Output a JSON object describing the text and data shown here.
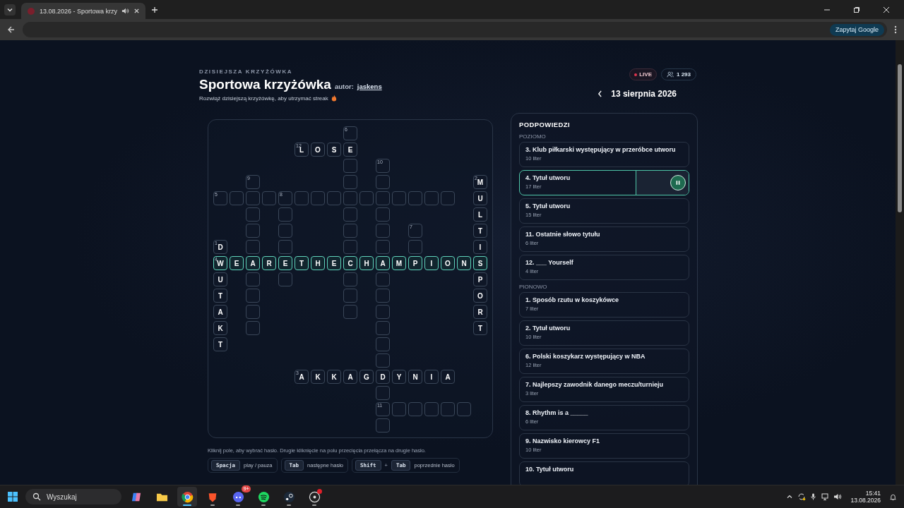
{
  "browser": {
    "tab_title": "13.08.2026 - Sportowa krzy",
    "ask_google": "Zapytaj Google"
  },
  "header": {
    "eyebrow": "DZISIEJSZA KRZYŻÓWKA",
    "title": "Sportowa krzyżówka",
    "author_label": "autor:",
    "author": "jaskens",
    "subtitle": "Rozwiąż dzisiejszą krzyżówkę, aby utrzymać streak",
    "live": "LIVE",
    "viewers": "1 293",
    "date": "13 sierpnia 2026"
  },
  "grid": [
    [
      {
        "kind": "empty"
      },
      {
        "kind": "empty"
      },
      {
        "kind": "empty"
      },
      {
        "kind": "empty"
      },
      {
        "kind": "empty"
      },
      {
        "kind": "empty"
      },
      {
        "kind": "empty"
      },
      {
        "kind": "empty"
      },
      {
        "kind": "square",
        "number": "6",
        "active": false
      },
      {
        "kind": "empty"
      },
      {
        "kind": "empty"
      },
      {
        "kind": "empty"
      },
      {
        "kind": "empty"
      },
      {
        "kind": "empty"
      },
      {
        "kind": "empty"
      },
      {
        "kind": "empty"
      },
      {
        "kind": "empty"
      }
    ],
    [
      {
        "kind": "empty"
      },
      {
        "kind": "empty"
      },
      {
        "kind": "empty"
      },
      {
        "kind": "empty"
      },
      {
        "kind": "empty"
      },
      {
        "kind": "square",
        "number": "12",
        "letter": "L",
        "active": false
      },
      {
        "kind": "square",
        "letter": "O",
        "active": false
      },
      {
        "kind": "square",
        "letter": "S",
        "active": false
      },
      {
        "kind": "square",
        "letter": "E",
        "active": false
      },
      {
        "kind": "empty"
      },
      {
        "kind": "empty"
      },
      {
        "kind": "empty"
      },
      {
        "kind": "empty"
      },
      {
        "kind": "empty"
      },
      {
        "kind": "empty"
      },
      {
        "kind": "empty"
      },
      {
        "kind": "empty"
      }
    ],
    [
      {
        "kind": "empty"
      },
      {
        "kind": "empty"
      },
      {
        "kind": "empty"
      },
      {
        "kind": "empty"
      },
      {
        "kind": "empty"
      },
      {
        "kind": "empty"
      },
      {
        "kind": "empty"
      },
      {
        "kind": "empty"
      },
      {
        "kind": "square",
        "active": false
      },
      {
        "kind": "empty"
      },
      {
        "kind": "square",
        "number": "10",
        "active": false
      },
      {
        "kind": "empty"
      },
      {
        "kind": "empty"
      },
      {
        "kind": "empty"
      },
      {
        "kind": "empty"
      },
      {
        "kind": "empty"
      },
      {
        "kind": "empty"
      }
    ],
    [
      {
        "kind": "empty"
      },
      {
        "kind": "empty"
      },
      {
        "kind": "square",
        "number": "9",
        "active": false
      },
      {
        "kind": "empty"
      },
      {
        "kind": "empty"
      },
      {
        "kind": "empty"
      },
      {
        "kind": "empty"
      },
      {
        "kind": "empty"
      },
      {
        "kind": "square",
        "active": false
      },
      {
        "kind": "empty"
      },
      {
        "kind": "square",
        "active": false
      },
      {
        "kind": "empty"
      },
      {
        "kind": "empty"
      },
      {
        "kind": "empty"
      },
      {
        "kind": "empty"
      },
      {
        "kind": "empty"
      },
      {
        "kind": "square",
        "number": "2",
        "letter": "M",
        "active": false
      }
    ],
    [
      {
        "kind": "square",
        "number": "5",
        "active": false
      },
      {
        "kind": "square",
        "active": false
      },
      {
        "kind": "square",
        "active": false
      },
      {
        "kind": "square",
        "active": false
      },
      {
        "kind": "square",
        "number": "8",
        "active": false
      },
      {
        "kind": "square",
        "active": false
      },
      {
        "kind": "square",
        "active": false
      },
      {
        "kind": "square",
        "active": false
      },
      {
        "kind": "square",
        "active": false
      },
      {
        "kind": "square",
        "active": false
      },
      {
        "kind": "square",
        "active": false
      },
      {
        "kind": "square",
        "active": false
      },
      {
        "kind": "square",
        "active": false
      },
      {
        "kind": "square",
        "active": false
      },
      {
        "kind": "square",
        "active": false
      },
      {
        "kind": "empty"
      },
      {
        "kind": "square",
        "letter": "U",
        "active": false
      }
    ],
    [
      {
        "kind": "empty"
      },
      {
        "kind": "empty"
      },
      {
        "kind": "square",
        "active": false
      },
      {
        "kind": "empty"
      },
      {
        "kind": "square",
        "active": false
      },
      {
        "kind": "empty"
      },
      {
        "kind": "empty"
      },
      {
        "kind": "empty"
      },
      {
        "kind": "square",
        "active": false
      },
      {
        "kind": "empty"
      },
      {
        "kind": "square",
        "active": false
      },
      {
        "kind": "empty"
      },
      {
        "kind": "empty"
      },
      {
        "kind": "empty"
      },
      {
        "kind": "empty"
      },
      {
        "kind": "empty"
      },
      {
        "kind": "square",
        "letter": "L",
        "active": false
      }
    ],
    [
      {
        "kind": "empty"
      },
      {
        "kind": "empty"
      },
      {
        "kind": "square",
        "active": false
      },
      {
        "kind": "empty"
      },
      {
        "kind": "square",
        "active": false
      },
      {
        "kind": "empty"
      },
      {
        "kind": "empty"
      },
      {
        "kind": "empty"
      },
      {
        "kind": "square",
        "active": false
      },
      {
        "kind": "empty"
      },
      {
        "kind": "square",
        "active": false
      },
      {
        "kind": "empty"
      },
      {
        "kind": "square",
        "number": "7",
        "active": false
      },
      {
        "kind": "empty"
      },
      {
        "kind": "empty"
      },
      {
        "kind": "empty"
      },
      {
        "kind": "square",
        "letter": "T",
        "active": false
      }
    ],
    [
      {
        "kind": "square",
        "number": "1",
        "letter": "D",
        "active": false
      },
      {
        "kind": "empty"
      },
      {
        "kind": "square",
        "active": false
      },
      {
        "kind": "empty"
      },
      {
        "kind": "square",
        "active": false
      },
      {
        "kind": "empty"
      },
      {
        "kind": "empty"
      },
      {
        "kind": "empty"
      },
      {
        "kind": "square",
        "active": false
      },
      {
        "kind": "empty"
      },
      {
        "kind": "square",
        "active": false
      },
      {
        "kind": "empty"
      },
      {
        "kind": "square",
        "active": false
      },
      {
        "kind": "empty"
      },
      {
        "kind": "empty"
      },
      {
        "kind": "empty"
      },
      {
        "kind": "square",
        "letter": "I",
        "active": false
      }
    ],
    [
      {
        "kind": "square",
        "number": "4",
        "letter": "W",
        "active": true
      },
      {
        "kind": "square",
        "letter": "E",
        "active": true
      },
      {
        "kind": "square",
        "letter": "A",
        "active": true
      },
      {
        "kind": "square",
        "letter": "R",
        "active": true
      },
      {
        "kind": "square",
        "letter": "E",
        "active": true
      },
      {
        "kind": "square",
        "letter": "T",
        "active": true
      },
      {
        "kind": "square",
        "letter": "H",
        "active": true
      },
      {
        "kind": "square",
        "letter": "E",
        "active": true
      },
      {
        "kind": "square",
        "letter": "C",
        "active": true
      },
      {
        "kind": "square",
        "letter": "H",
        "active": true
      },
      {
        "kind": "square",
        "letter": "A",
        "active": true
      },
      {
        "kind": "square",
        "letter": "M",
        "active": true
      },
      {
        "kind": "square",
        "letter": "P",
        "active": true
      },
      {
        "kind": "square",
        "letter": "I",
        "active": true
      },
      {
        "kind": "square",
        "letter": "O",
        "active": true
      },
      {
        "kind": "square",
        "letter": "N",
        "active": true
      },
      {
        "kind": "square",
        "letter": "S",
        "active": true
      }
    ],
    [
      {
        "kind": "square",
        "letter": "U",
        "active": false
      },
      {
        "kind": "empty"
      },
      {
        "kind": "square",
        "active": false
      },
      {
        "kind": "empty"
      },
      {
        "kind": "square",
        "active": false
      },
      {
        "kind": "empty"
      },
      {
        "kind": "empty"
      },
      {
        "kind": "empty"
      },
      {
        "kind": "square",
        "active": false
      },
      {
        "kind": "empty"
      },
      {
        "kind": "square",
        "active": false
      },
      {
        "kind": "empty"
      },
      {
        "kind": "empty"
      },
      {
        "kind": "empty"
      },
      {
        "kind": "empty"
      },
      {
        "kind": "empty"
      },
      {
        "kind": "square",
        "letter": "P",
        "active": false
      }
    ],
    [
      {
        "kind": "square",
        "letter": "T",
        "active": false
      },
      {
        "kind": "empty"
      },
      {
        "kind": "square",
        "active": false
      },
      {
        "kind": "empty"
      },
      {
        "kind": "empty"
      },
      {
        "kind": "empty"
      },
      {
        "kind": "empty"
      },
      {
        "kind": "empty"
      },
      {
        "kind": "square",
        "active": false
      },
      {
        "kind": "empty"
      },
      {
        "kind": "square",
        "active": false
      },
      {
        "kind": "empty"
      },
      {
        "kind": "empty"
      },
      {
        "kind": "empty"
      },
      {
        "kind": "empty"
      },
      {
        "kind": "empty"
      },
      {
        "kind": "square",
        "letter": "O",
        "active": false
      }
    ],
    [
      {
        "kind": "square",
        "letter": "A",
        "active": false
      },
      {
        "kind": "empty"
      },
      {
        "kind": "square",
        "active": false
      },
      {
        "kind": "empty"
      },
      {
        "kind": "empty"
      },
      {
        "kind": "empty"
      },
      {
        "kind": "empty"
      },
      {
        "kind": "empty"
      },
      {
        "kind": "square",
        "active": false
      },
      {
        "kind": "empty"
      },
      {
        "kind": "square",
        "active": false
      },
      {
        "kind": "empty"
      },
      {
        "kind": "empty"
      },
      {
        "kind": "empty"
      },
      {
        "kind": "empty"
      },
      {
        "kind": "empty"
      },
      {
        "kind": "square",
        "letter": "R",
        "active": false
      }
    ],
    [
      {
        "kind": "square",
        "letter": "K",
        "active": false
      },
      {
        "kind": "empty"
      },
      {
        "kind": "square",
        "active": false
      },
      {
        "kind": "empty"
      },
      {
        "kind": "empty"
      },
      {
        "kind": "empty"
      },
      {
        "kind": "empty"
      },
      {
        "kind": "empty"
      },
      {
        "kind": "empty"
      },
      {
        "kind": "empty"
      },
      {
        "kind": "square",
        "active": false
      },
      {
        "kind": "empty"
      },
      {
        "kind": "empty"
      },
      {
        "kind": "empty"
      },
      {
        "kind": "empty"
      },
      {
        "kind": "empty"
      },
      {
        "kind": "square",
        "letter": "T",
        "active": false
      }
    ],
    [
      {
        "kind": "square",
        "letter": "T",
        "active": false
      },
      {
        "kind": "empty"
      },
      {
        "kind": "empty"
      },
      {
        "kind": "empty"
      },
      {
        "kind": "empty"
      },
      {
        "kind": "empty"
      },
      {
        "kind": "empty"
      },
      {
        "kind": "empty"
      },
      {
        "kind": "empty"
      },
      {
        "kind": "empty"
      },
      {
        "kind": "square",
        "active": false
      },
      {
        "kind": "empty"
      },
      {
        "kind": "empty"
      },
      {
        "kind": "empty"
      },
      {
        "kind": "empty"
      },
      {
        "kind": "empty"
      },
      {
        "kind": "empty"
      }
    ],
    [
      {
        "kind": "empty"
      },
      {
        "kind": "empty"
      },
      {
        "kind": "empty"
      },
      {
        "kind": "empty"
      },
      {
        "kind": "empty"
      },
      {
        "kind": "empty"
      },
      {
        "kind": "empty"
      },
      {
        "kind": "empty"
      },
      {
        "kind": "empty"
      },
      {
        "kind": "empty"
      },
      {
        "kind": "square",
        "active": false
      },
      {
        "kind": "empty"
      },
      {
        "kind": "empty"
      },
      {
        "kind": "empty"
      },
      {
        "kind": "empty"
      },
      {
        "kind": "empty"
      },
      {
        "kind": "empty"
      }
    ],
    [
      {
        "kind": "empty"
      },
      {
        "kind": "empty"
      },
      {
        "kind": "empty"
      },
      {
        "kind": "empty"
      },
      {
        "kind": "empty"
      },
      {
        "kind": "square",
        "number": "3",
        "letter": "A",
        "active": false
      },
      {
        "kind": "square",
        "letter": "K",
        "active": false
      },
      {
        "kind": "square",
        "letter": "K",
        "active": false
      },
      {
        "kind": "square",
        "letter": "A",
        "active": false
      },
      {
        "kind": "square",
        "letter": "G",
        "active": false
      },
      {
        "kind": "square",
        "letter": "D",
        "active": false
      },
      {
        "kind": "square",
        "letter": "Y",
        "active": false
      },
      {
        "kind": "square",
        "letter": "N",
        "active": false
      },
      {
        "kind": "square",
        "letter": "I",
        "active": false
      },
      {
        "kind": "square",
        "letter": "A",
        "active": false
      },
      {
        "kind": "empty"
      },
      {
        "kind": "empty"
      }
    ],
    [
      {
        "kind": "empty"
      },
      {
        "kind": "empty"
      },
      {
        "kind": "empty"
      },
      {
        "kind": "empty"
      },
      {
        "kind": "empty"
      },
      {
        "kind": "empty"
      },
      {
        "kind": "empty"
      },
      {
        "kind": "empty"
      },
      {
        "kind": "empty"
      },
      {
        "kind": "empty"
      },
      {
        "kind": "square",
        "active": false
      },
      {
        "kind": "empty"
      },
      {
        "kind": "empty"
      },
      {
        "kind": "empty"
      },
      {
        "kind": "empty"
      },
      {
        "kind": "empty"
      },
      {
        "kind": "empty"
      }
    ],
    [
      {
        "kind": "empty"
      },
      {
        "kind": "empty"
      },
      {
        "kind": "empty"
      },
      {
        "kind": "empty"
      },
      {
        "kind": "empty"
      },
      {
        "kind": "empty"
      },
      {
        "kind": "empty"
      },
      {
        "kind": "empty"
      },
      {
        "kind": "empty"
      },
      {
        "kind": "empty"
      },
      {
        "kind": "square",
        "number": "11",
        "active": false
      },
      {
        "kind": "square",
        "active": false
      },
      {
        "kind": "square",
        "active": false
      },
      {
        "kind": "square",
        "active": false
      },
      {
        "kind": "square",
        "active": false
      },
      {
        "kind": "square",
        "active": false
      },
      {
        "kind": "empty"
      }
    ],
    [
      {
        "kind": "empty"
      },
      {
        "kind": "empty"
      },
      {
        "kind": "empty"
      },
      {
        "kind": "empty"
      },
      {
        "kind": "empty"
      },
      {
        "kind": "empty"
      },
      {
        "kind": "empty"
      },
      {
        "kind": "empty"
      },
      {
        "kind": "empty"
      },
      {
        "kind": "empty"
      },
      {
        "kind": "square",
        "active": false
      },
      {
        "kind": "empty"
      },
      {
        "kind": "empty"
      },
      {
        "kind": "empty"
      },
      {
        "kind": "empty"
      },
      {
        "kind": "empty"
      },
      {
        "kind": "empty"
      }
    ]
  ],
  "clues": {
    "title": "PODPOWIEDZI",
    "sections": [
      {
        "label": "POZIOMO",
        "items": [
          {
            "text": "3. Klub piłkarski występujący w przeróbce utworu",
            "length": "10 liter",
            "selected": false
          },
          {
            "text": "4. Tytuł utworu",
            "length": "17 liter",
            "selected": true
          },
          {
            "text": "5. Tytuł utworu",
            "length": "15 liter",
            "selected": false
          },
          {
            "text": "11. Ostatnie słowo tytułu",
            "length": "6 liter",
            "selected": false
          },
          {
            "text": "12. ___ Yourself",
            "length": "4 liter",
            "selected": false
          }
        ]
      },
      {
        "label": "PIONOWO",
        "items": [
          {
            "text": "1. Sposób rzutu w koszykówce",
            "length": "7 liter",
            "selected": false
          },
          {
            "text": "2. Tytuł utworu",
            "length": "10 liter",
            "selected": false
          },
          {
            "text": "6. Polski koszykarz występujący w NBA",
            "length": "12 liter",
            "selected": false
          },
          {
            "text": "7. Najlepszy zawodnik danego meczu/turnieju",
            "length": "3 liter",
            "selected": false
          },
          {
            "text": "8. Rhythm is a _____",
            "length": "6 liter",
            "selected": false
          },
          {
            "text": "9. Nazwisko kierowcy F1",
            "length": "10 liter",
            "selected": false
          },
          {
            "text": "10. Tytuł utworu",
            "selected": false
          }
        ]
      }
    ]
  },
  "help": "Kliknij pole, aby wybrać hasło. Drugie kliknięcie na polu przecięcia przełącza na drugie hasło.",
  "shortcuts": [
    {
      "keys": [
        "Spacja"
      ],
      "label": "play / pauza"
    },
    {
      "keys": [
        "Tab"
      ],
      "label": "następne hasło"
    },
    {
      "keys": [
        "Shift",
        "Tab"
      ],
      "joiner": "+",
      "label": "poprzednie hasło"
    }
  ],
  "taskbar": {
    "search": "Wyszukaj",
    "apps": [
      {
        "running": false,
        "active": false
      },
      {
        "running": false,
        "active": false
      },
      {
        "running": true,
        "active": true
      },
      {
        "running": true,
        "active": false
      },
      {
        "running": true,
        "active": false,
        "badge": "9+"
      },
      {
        "running": true,
        "active": false
      },
      {
        "running": true,
        "active": false
      },
      {
        "running": true,
        "active": false,
        "alert": true
      }
    ],
    "time": "15:41",
    "date": "13.08.2026"
  }
}
